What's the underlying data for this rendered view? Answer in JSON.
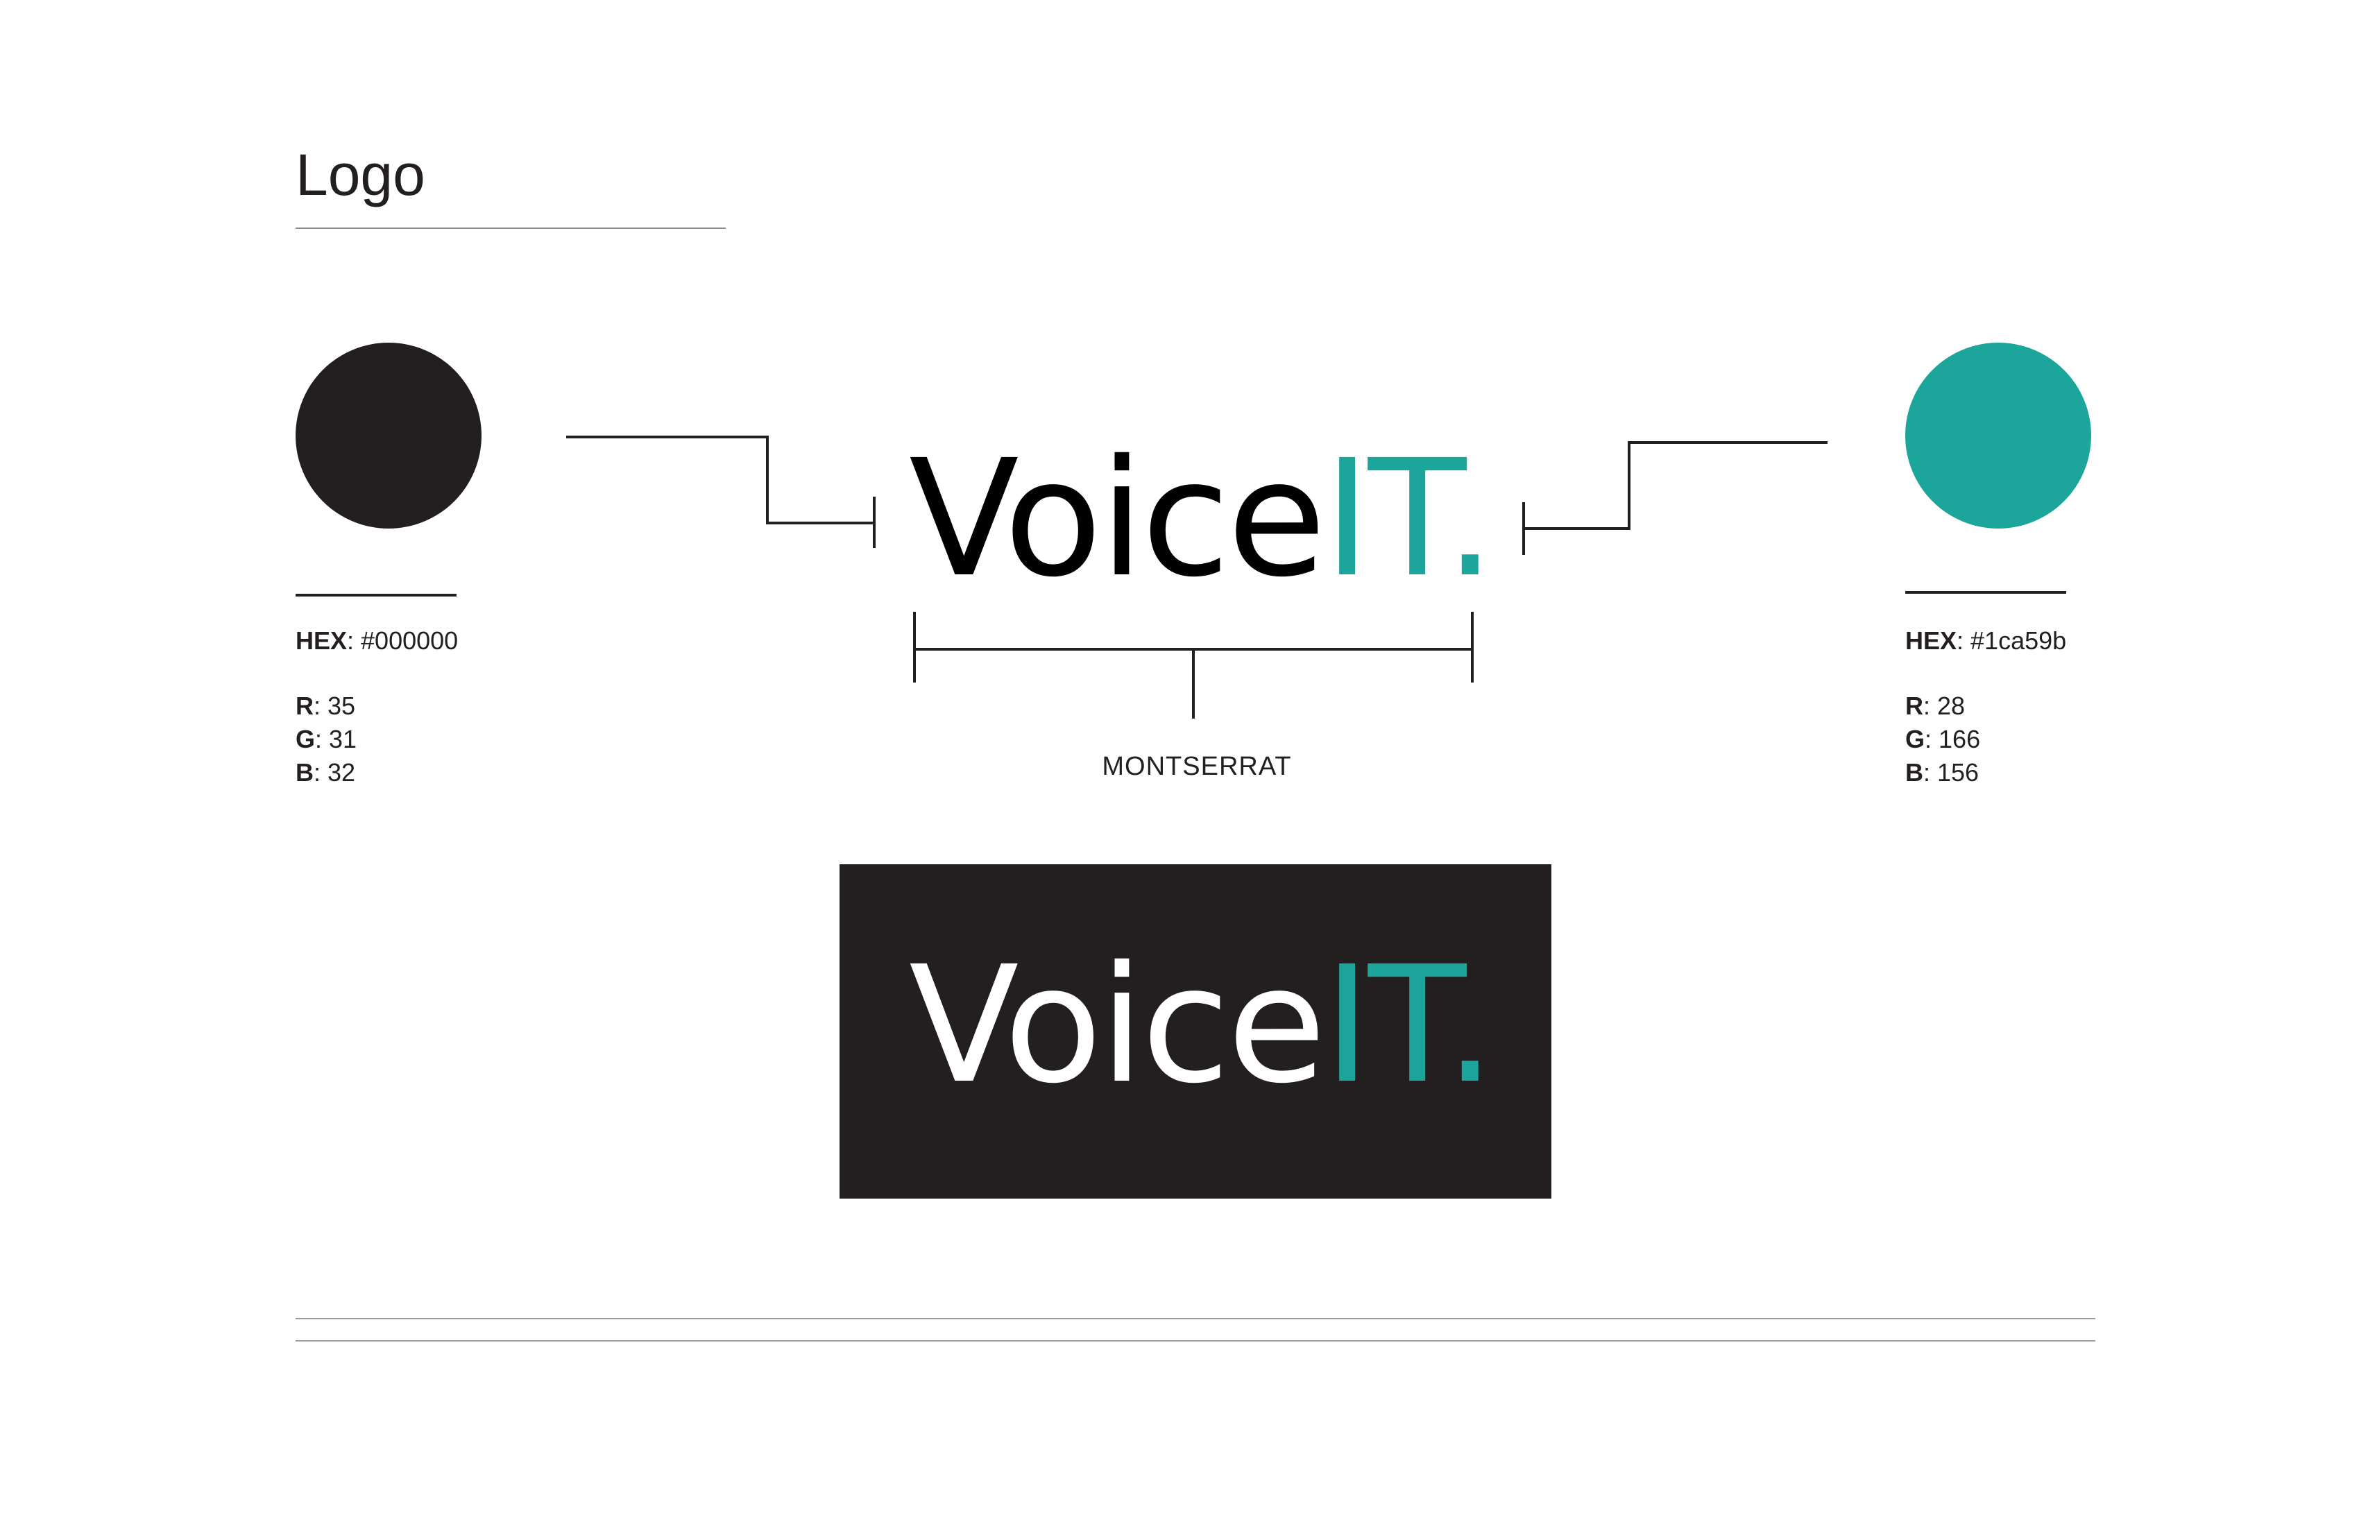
{
  "page": {
    "title": "Logo"
  },
  "brand": {
    "name_main": "Voice",
    "name_accent": "IT.",
    "font_name": "MONTSERRAT"
  },
  "colors": {
    "dark": {
      "swatch_hex": "#231f20",
      "hex_label": "HEX",
      "hex_value": ": #000000",
      "r_label": "R",
      "r_value": ": 35",
      "g_label": "G",
      "g_value": ": 31",
      "b_label": "B",
      "b_value": ": 32"
    },
    "teal": {
      "swatch_hex": "#1ca59b",
      "hex_label": "HEX",
      "hex_value": ": #1ca59b",
      "r_label": "R",
      "r_value": ": 28",
      "g_label": "G",
      "g_value": ": 166",
      "b_label": "B",
      "b_value": ": 156"
    },
    "block_background": "#231f20",
    "accent": "#1ca59b"
  }
}
